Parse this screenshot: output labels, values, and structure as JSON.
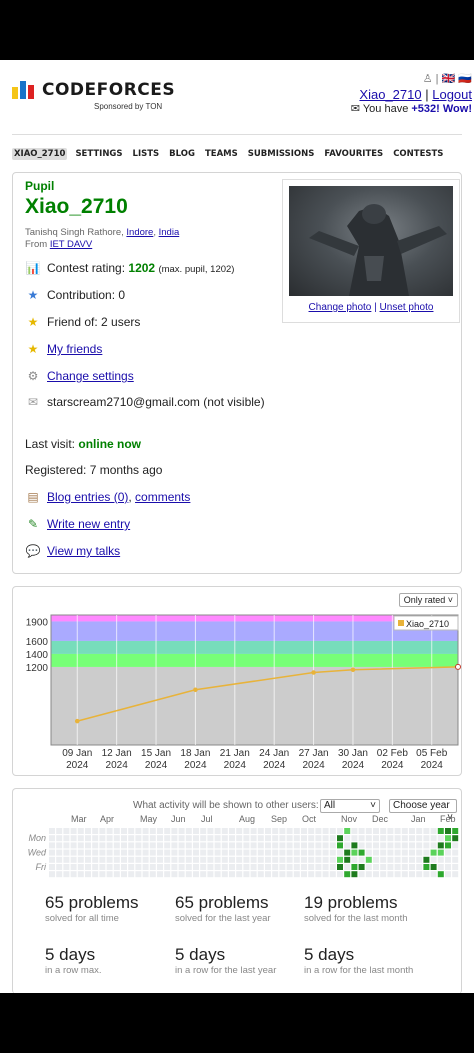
{
  "header": {
    "logo_text": "CODEFORCES",
    "sponsor": "Sponsored by TON",
    "lang_icons": "♙ | 🇬🇧 🇷🇺",
    "user_link": "Xiao_2710",
    "separator": "|",
    "logout": "Logout",
    "mail_prefix": "✉ You have ",
    "mail_count": "+532! Wow!"
  },
  "nav": [
    "XIAO_2710",
    "SETTINGS",
    "LISTS",
    "BLOG",
    "TEAMS",
    "SUBMISSIONS",
    "FAVOURITES",
    "CONTESTS"
  ],
  "profile": {
    "rank": "Pupil",
    "handle": "Xiao_2710",
    "name": "Tanishq Singh Rathore,",
    "city": "Indore",
    "country": "India",
    "from_label": "From",
    "org": "IET DAVV",
    "rating_label": "Contest rating:",
    "rating": "1202",
    "rating_max": "(max. pupil, 1202)",
    "contribution": "Contribution: 0",
    "friend_of": "Friend of: 2 users",
    "my_friends": "My friends",
    "change_settings": "Change settings",
    "email": "starscream2710@gmail.com (not visible)",
    "last_visit_label": "Last visit:",
    "last_visit": "online now",
    "registered": "Registered: 7 months ago",
    "blog_entries": "Blog entries (0)",
    "comments": "comments",
    "write_entry": "Write new entry",
    "view_talks": "View my talks",
    "change_photo": "Change photo",
    "unset_photo": "Unset photo"
  },
  "chart_data": {
    "type": "line",
    "filter": "Only rated ˅",
    "legend": "Xiao_2710",
    "y_ticks": [
      1200,
      1400,
      1600,
      1900
    ],
    "x_ticks": [
      {
        "d": "09 Jan",
        "y": "2024"
      },
      {
        "d": "12 Jan",
        "y": "2024"
      },
      {
        "d": "15 Jan",
        "y": "2024"
      },
      {
        "d": "18 Jan",
        "y": "2024"
      },
      {
        "d": "21 Jan",
        "y": "2024"
      },
      {
        "d": "24 Jan",
        "y": "2024"
      },
      {
        "d": "27 Jan",
        "y": "2024"
      },
      {
        "d": "30 Jan",
        "y": "2024"
      },
      {
        "d": "02 Feb",
        "y": "2024"
      },
      {
        "d": "05 Feb",
        "y": "2024"
      }
    ],
    "series": [
      {
        "name": "Xiao_2710",
        "points": [
          {
            "x": "2024-01-09",
            "y": 367
          },
          {
            "x": "2024-01-18",
            "y": 849
          },
          {
            "x": "2024-01-27",
            "y": 1115
          },
          {
            "x": "2024-01-30",
            "y": 1157
          },
          {
            "x": "2024-02-07",
            "y": 1202
          }
        ]
      }
    ],
    "ylim": [
      0,
      1999
    ],
    "bands": [
      {
        "from": 1900,
        "to": 1999,
        "color": "#ff88ff"
      },
      {
        "from": 1600,
        "to": 1900,
        "color": "#aaaaff"
      },
      {
        "from": 1400,
        "to": 1600,
        "color": "#77ddbb"
      },
      {
        "from": 1200,
        "to": 1400,
        "color": "#77ff77"
      },
      {
        "from": 0,
        "to": 1200,
        "color": "#cccccc"
      }
    ]
  },
  "activity": {
    "question": "What activity will be shown to other users:",
    "scope": "All",
    "year_select": "Choose year",
    "months": [
      "Mar",
      "Apr",
      "May",
      "Jun",
      "Jul",
      "Aug",
      "Sep",
      "Oct",
      "Nov",
      "Dec",
      "Jan",
      "Feb"
    ],
    "days": [
      "Mon",
      "Wed",
      "Fri"
    ],
    "stats": [
      {
        "num": "65 problems",
        "sub": "solved for all time"
      },
      {
        "num": "65 problems",
        "sub": "solved for the last year"
      },
      {
        "num": "19 problems",
        "sub": "solved for the last month"
      },
      {
        "num": "5 days",
        "sub": "in a row max."
      },
      {
        "num": "5 days",
        "sub": "in a row for the last year"
      },
      {
        "num": "5 days",
        "sub": "in a row for the last month"
      }
    ]
  },
  "colors": {
    "pupil": "#008000",
    "link": "#1a0dab"
  }
}
